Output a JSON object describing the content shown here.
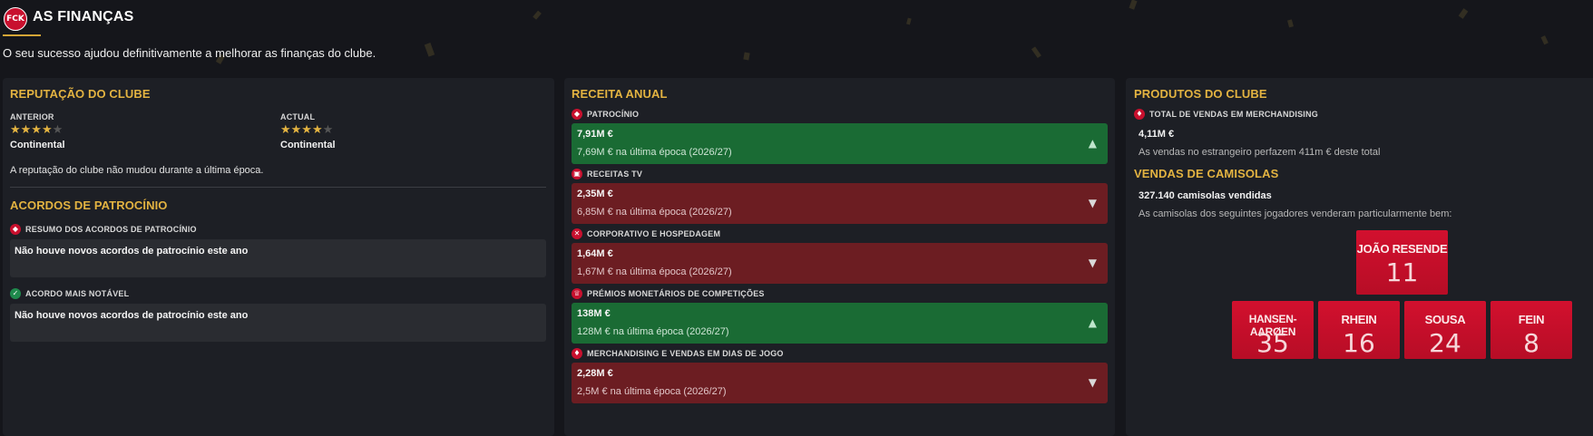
{
  "header": {
    "logo_text": "FCK",
    "title": "AS FINANÇAS",
    "subtitle": "O seu sucesso ajudou definitivamente a melhorar as finanças do clube."
  },
  "reputation": {
    "title": "REPUTAÇÃO DO CLUBE",
    "previous_label": "ANTERIOR",
    "previous_stars": "★★★★",
    "previous_stars_off": "★",
    "previous_level": "Continental",
    "current_label": "ACTUAL",
    "current_stars": "★★★★",
    "current_stars_off": "★",
    "current_level": "Continental",
    "note": "A reputação do clube não mudou durante a última época."
  },
  "sponsorship": {
    "title": "ACORDOS DE PATROCÍNIO",
    "summary_label": "RESUMO DOS ACORDOS DE PATROCÍNIO",
    "summary_text": "Não houve novos acordos de patrocínio este ano",
    "notable_label": "ACORDO MAIS NOTÁVEL",
    "notable_text": "Não houve novos acordos de patrocínio este ano"
  },
  "revenue": {
    "title": "RECEITA ANUAL",
    "items": [
      {
        "label": "PATROCÍNIO",
        "value": "7,91M €",
        "previous": "7,69M € na última época (2026/27)",
        "trend": "up",
        "arrow": "▲"
      },
      {
        "label": "RECEITAS TV",
        "value": "2,35M €",
        "previous": "6,85M € na última época (2026/27)",
        "trend": "down",
        "arrow": "▼"
      },
      {
        "label": "CORPORATIVO E HOSPEDAGEM",
        "value": "1,64M €",
        "previous": "1,67M € na última época (2026/27)",
        "trend": "down",
        "arrow": "▼"
      },
      {
        "label": "PRÉMIOS MONETÁRIOS DE COMPETIÇÕES",
        "value": "138M €",
        "previous": "128M € na última época (2026/27)",
        "trend": "up",
        "arrow": "▲"
      },
      {
        "label": "MERCHANDISING E VENDAS EM DIAS DE JOGO",
        "value": "2,28M €",
        "previous": "2,5M € na última época (2026/27)",
        "trend": "down",
        "arrow": "▼"
      }
    ]
  },
  "products": {
    "title": "PRODUTOS DO CLUBE",
    "merch_label": "TOTAL DE VENDAS EM MERCHANDISING",
    "merch_value": "4,11M €",
    "merch_note": "As vendas no estrangeiro perfazem 411m € deste total"
  },
  "shirts": {
    "title": "VENDAS DE CAMISOLAS",
    "sold": "327.140 camisolas vendidas",
    "note": "As camisolas dos seguintes jogadores venderam particularmente bem:",
    "players": [
      {
        "name": "JOÃO RESENDE",
        "number": "11"
      },
      {
        "name": "HANSEN-AARØEN",
        "number": "35"
      },
      {
        "name": "RHEIN",
        "number": "16"
      },
      {
        "name": "SOUSA",
        "number": "24"
      },
      {
        "name": "FEIN",
        "number": "8"
      }
    ]
  },
  "colors": {
    "accent": "#e3b341",
    "up": "#1a6b34",
    "down": "#6c1d22",
    "jersey": "#c8102e"
  }
}
